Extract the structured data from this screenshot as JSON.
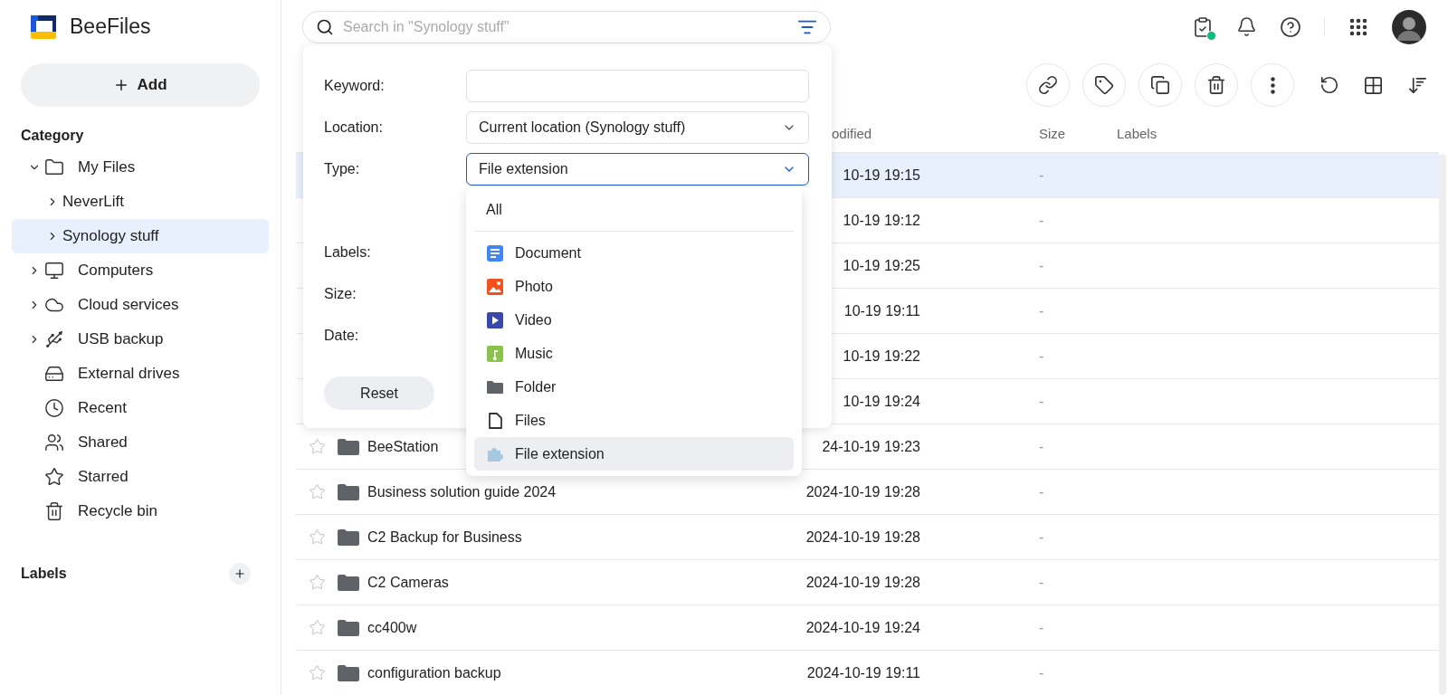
{
  "app": {
    "name": "BeeFiles"
  },
  "sidebar": {
    "add_button": "Add",
    "category_heading": "Category",
    "items": [
      {
        "label": "My Files",
        "kind": "branch",
        "expanded": true,
        "selected": false,
        "children": [
          {
            "label": "NeverLift",
            "kind": "branch",
            "expanded": false,
            "selected": false
          },
          {
            "label": "Synology stuff",
            "kind": "branch",
            "expanded": false,
            "selected": true
          }
        ]
      },
      {
        "label": "Computers",
        "kind": "branch",
        "expanded": false,
        "selected": false
      },
      {
        "label": "Cloud services",
        "kind": "branch",
        "expanded": false,
        "selected": false
      },
      {
        "label": "USB backup",
        "kind": "branch",
        "expanded": false,
        "selected": false
      },
      {
        "label": "External drives",
        "kind": "leaf",
        "selected": false
      },
      {
        "label": "Recent",
        "kind": "leaf",
        "selected": false
      },
      {
        "label": "Shared",
        "kind": "leaf",
        "selected": false
      },
      {
        "label": "Starred",
        "kind": "leaf",
        "selected": false
      },
      {
        "label": "Recycle bin",
        "kind": "leaf",
        "selected": false
      }
    ],
    "labels_heading": "Labels"
  },
  "search": {
    "placeholder": "Search in \"Synology stuff\""
  },
  "filter_panel": {
    "fields": [
      {
        "label": "Keyword:",
        "kind": "input",
        "focused": false
      },
      {
        "label": "Location:",
        "kind": "select",
        "value": "Current location (Synology stuff)",
        "focused": false
      },
      {
        "label": "Type:",
        "kind": "select",
        "value": "File extension",
        "focused": true
      },
      {
        "label": "Labels:"
      },
      {
        "label": "Size:"
      },
      {
        "label": "Date:"
      }
    ],
    "reset_button": "Reset"
  },
  "type_dropdown": {
    "items": [
      {
        "label": "All",
        "kind": "all",
        "selected": false
      },
      {
        "label": "Document",
        "kind": "document",
        "selected": false
      },
      {
        "label": "Photo",
        "kind": "photo",
        "selected": false
      },
      {
        "label": "Video",
        "kind": "video",
        "selected": false
      },
      {
        "label": "Music",
        "kind": "music",
        "selected": false
      },
      {
        "label": "Folder",
        "kind": "folder",
        "selected": false
      },
      {
        "label": "Files",
        "kind": "files",
        "selected": false
      },
      {
        "label": "File extension",
        "kind": "extension",
        "selected": true
      }
    ]
  },
  "table": {
    "columns": [
      "odified",
      "Size",
      "Labels"
    ],
    "rows": [
      {
        "modified": "10-19 19:15",
        "size": "-",
        "selected": true
      },
      {
        "modified": "10-19 19:12",
        "size": "-",
        "selected": false
      },
      {
        "modified": "10-19 19:25",
        "size": "-",
        "selected": false
      },
      {
        "modified": "10-19 19:11",
        "size": "-",
        "selected": false
      },
      {
        "modified": "10-19 19:22",
        "size": "-",
        "selected": false
      },
      {
        "modified": "10-19 19:24",
        "size": "-",
        "selected": false
      },
      {
        "name": "BeeStation",
        "starred": false,
        "modified": "24-10-19 19:23",
        "size": "-",
        "selected": false
      },
      {
        "name": "Business solution guide 2024",
        "starred": false,
        "modified": "2024-10-19 19:28",
        "size": "-",
        "selected": false
      },
      {
        "name": "C2 Backup for Business",
        "starred": false,
        "modified": "2024-10-19 19:28",
        "size": "-",
        "selected": false
      },
      {
        "name": "C2 Cameras",
        "starred": false,
        "modified": "2024-10-19 19:28",
        "size": "-",
        "selected": false
      },
      {
        "name": "cc400w",
        "starred": false,
        "modified": "2024-10-19 19:24",
        "size": "-",
        "selected": false
      },
      {
        "name": "configuration backup",
        "starred": false,
        "modified": "2024-10-19 19:11",
        "size": "-",
        "selected": false
      }
    ]
  }
}
